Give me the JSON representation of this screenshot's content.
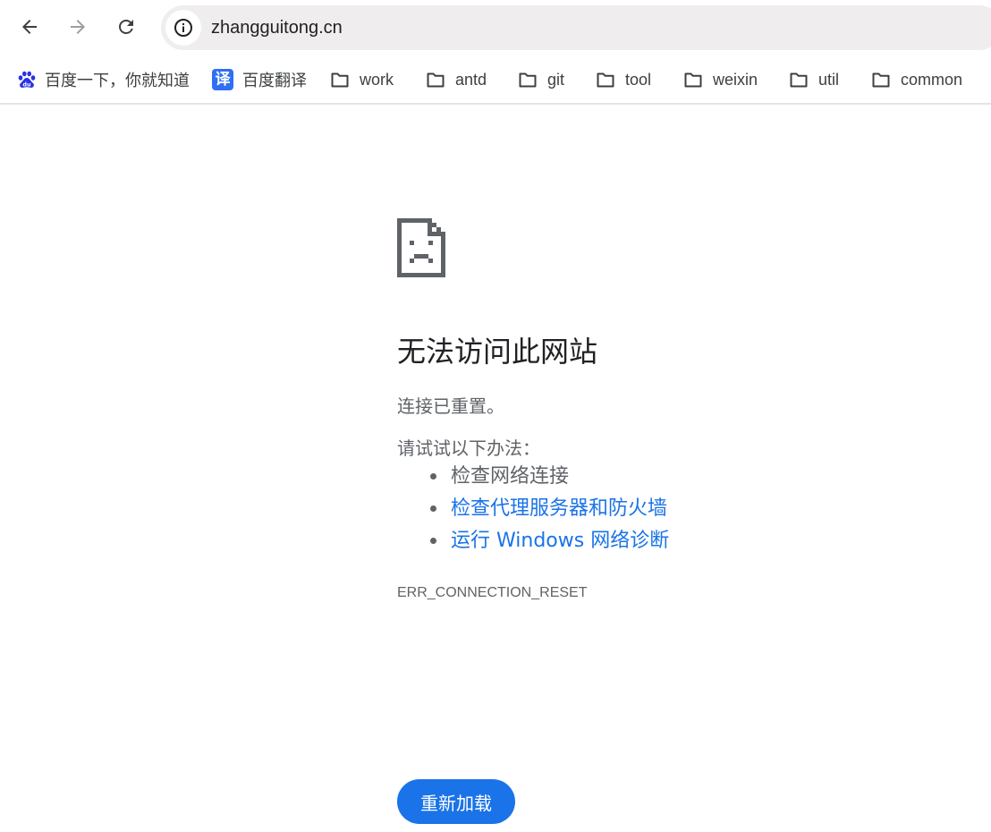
{
  "toolbar": {
    "url": "zhangguitong.cn",
    "back_icon": "arrow-back-icon",
    "forward_icon": "arrow-forward-icon",
    "reload_icon": "reload-icon",
    "site_info_icon": "info-icon"
  },
  "bookmarks": [
    {
      "label": "百度一下，你就知道",
      "icon": "baidu-icon"
    },
    {
      "label": "百度翻译",
      "icon": "fanyi-icon",
      "icon_glyph": "译"
    },
    {
      "label": "work",
      "icon": "folder-icon"
    },
    {
      "label": "antd",
      "icon": "folder-icon"
    },
    {
      "label": "git",
      "icon": "folder-icon"
    },
    {
      "label": "tool",
      "icon": "folder-icon"
    },
    {
      "label": "weixin",
      "icon": "folder-icon"
    },
    {
      "label": "util",
      "icon": "folder-icon"
    },
    {
      "label": "common",
      "icon": "folder-icon"
    }
  ],
  "error": {
    "icon": "sad-page-icon",
    "title": "无法访问此网站",
    "subtitle": "连接已重置。",
    "try_label": "请试试以下办法：",
    "suggestions": [
      {
        "text": "检查网络连接",
        "link": false
      },
      {
        "text": "检查代理服务器和防火墙",
        "link": true
      },
      {
        "text": "运行 Windows 网络诊断",
        "link": true
      }
    ],
    "code": "ERR_CONNECTION_RESET",
    "reload_label": "重新加载"
  },
  "colors": {
    "accent": "#1a73e8",
    "text_secondary": "#5f6368",
    "omnibox_bg": "#efeded"
  }
}
